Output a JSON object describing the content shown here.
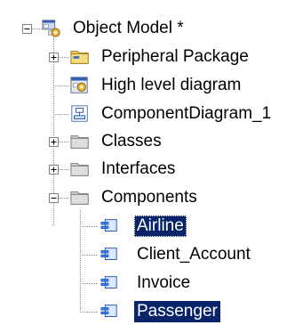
{
  "tree": {
    "root": {
      "label": "Object Model *",
      "icon": "model-icon",
      "expanded": true
    },
    "children": [
      {
        "label": "Peripheral Package",
        "icon": "package-icon",
        "expander": "plus"
      },
      {
        "label": "High level diagram",
        "icon": "diagram-icon",
        "expander": "none"
      },
      {
        "label": "ComponentDiagram_1",
        "icon": "component-diagram-icon",
        "expander": "none"
      },
      {
        "label": "Classes",
        "icon": "folder-icon",
        "expander": "plus"
      },
      {
        "label": "Interfaces",
        "icon": "folder-icon",
        "expander": "plus"
      },
      {
        "label": "Components",
        "icon": "folder-icon",
        "expander": "minus",
        "children": [
          {
            "label": "Airline",
            "icon": "component-icon",
            "selected": true
          },
          {
            "label": "Client_Account",
            "icon": "component-icon",
            "selected": false
          },
          {
            "label": "Invoice",
            "icon": "component-icon",
            "selected": false
          },
          {
            "label": "Passenger",
            "icon": "component-icon",
            "selected": true
          }
        ]
      }
    ]
  },
  "colors": {
    "selection_bg": "#0a246a",
    "selection_fg": "#ffffff",
    "guide_line": "#808080"
  }
}
